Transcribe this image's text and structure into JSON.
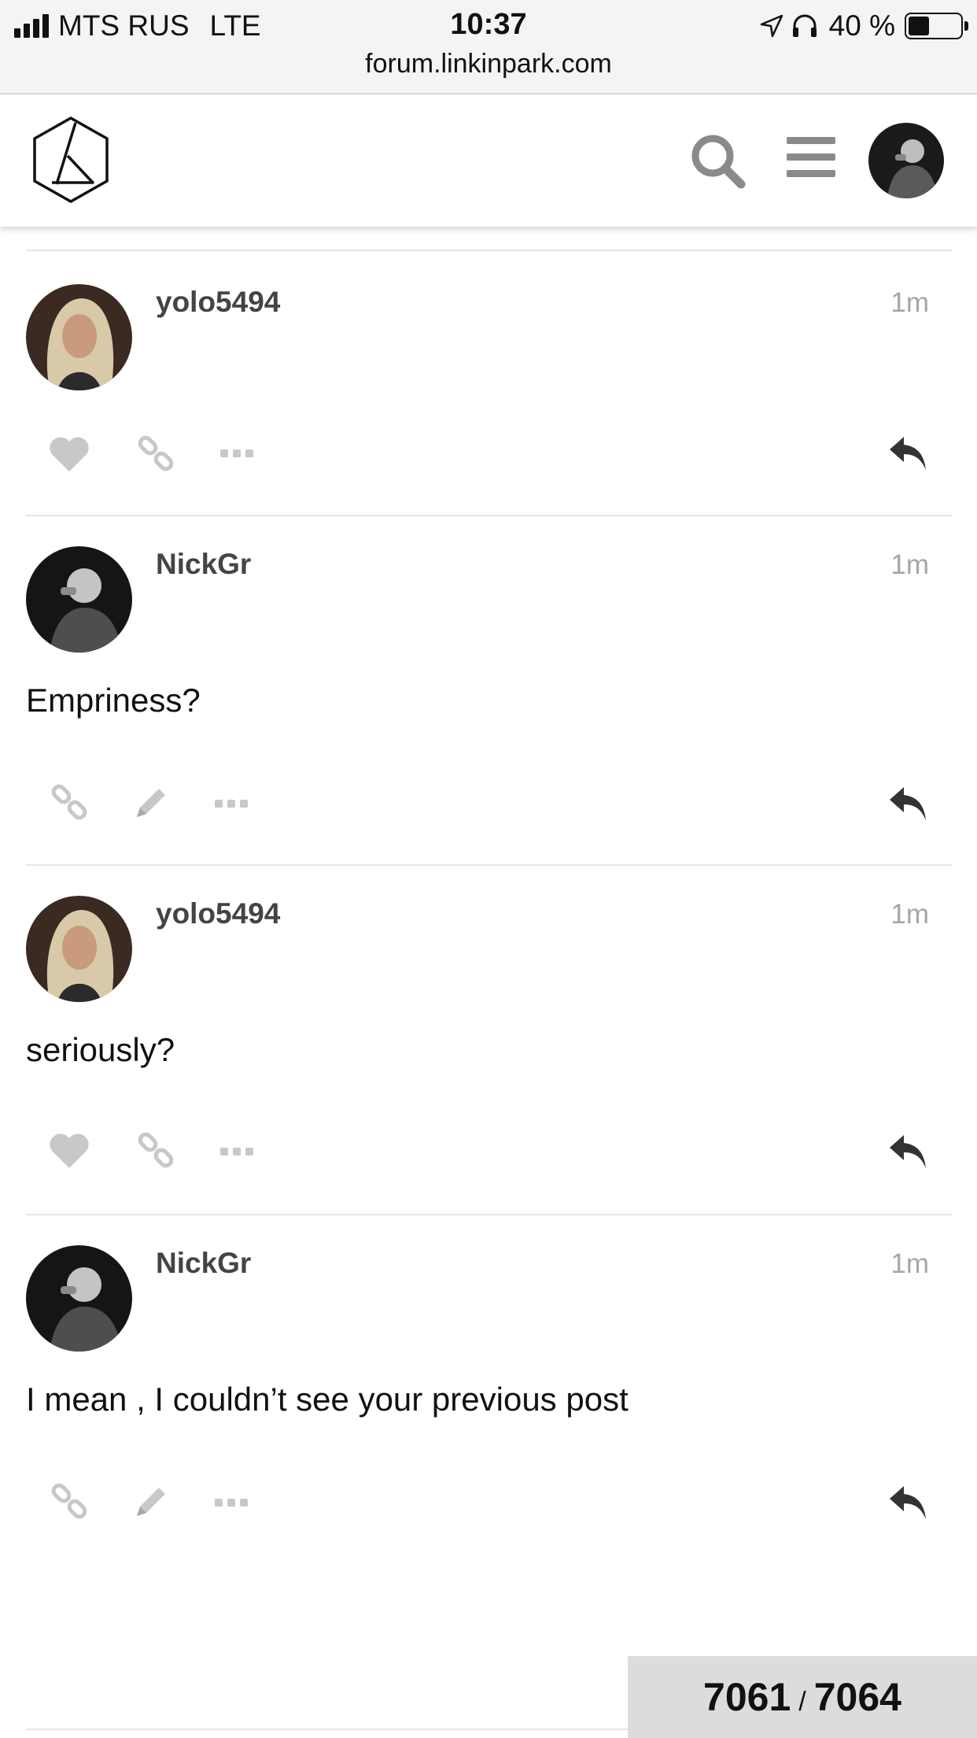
{
  "status_bar": {
    "carrier": "MTS RUS",
    "network": "LTE",
    "time": "10:37",
    "url": "forum.linkinpark.com",
    "battery": "40 %",
    "battery_level": 0.4
  },
  "header": {
    "logo_icon": "linkin-park-hexagon-logo",
    "search_icon": "search-icon",
    "menu_icon": "hamburger-menu-icon",
    "avatar_icon": "user-avatar"
  },
  "posts": [
    {
      "username": "yolo5494",
      "time": "1m",
      "body": "",
      "actions": [
        "like",
        "link",
        "more"
      ]
    },
    {
      "username": "NickGr",
      "time": "1m",
      "body": "Empriness?",
      "actions": [
        "link",
        "edit",
        "more"
      ]
    },
    {
      "username": "yolo5494",
      "time": "1m",
      "body": "seriously?",
      "actions": [
        "like",
        "link",
        "more"
      ]
    },
    {
      "username": "NickGr",
      "time": "1m",
      "body": "I mean , I couldn’t see your previous post",
      "actions": [
        "link",
        "edit",
        "more"
      ]
    }
  ],
  "progress": {
    "current": "7061",
    "separator": "/",
    "total": "7064"
  },
  "colors": {
    "icon_gray": "#c8c8c8",
    "reply_dark": "#333333",
    "username": "#444444",
    "time": "#a6a6a6"
  }
}
